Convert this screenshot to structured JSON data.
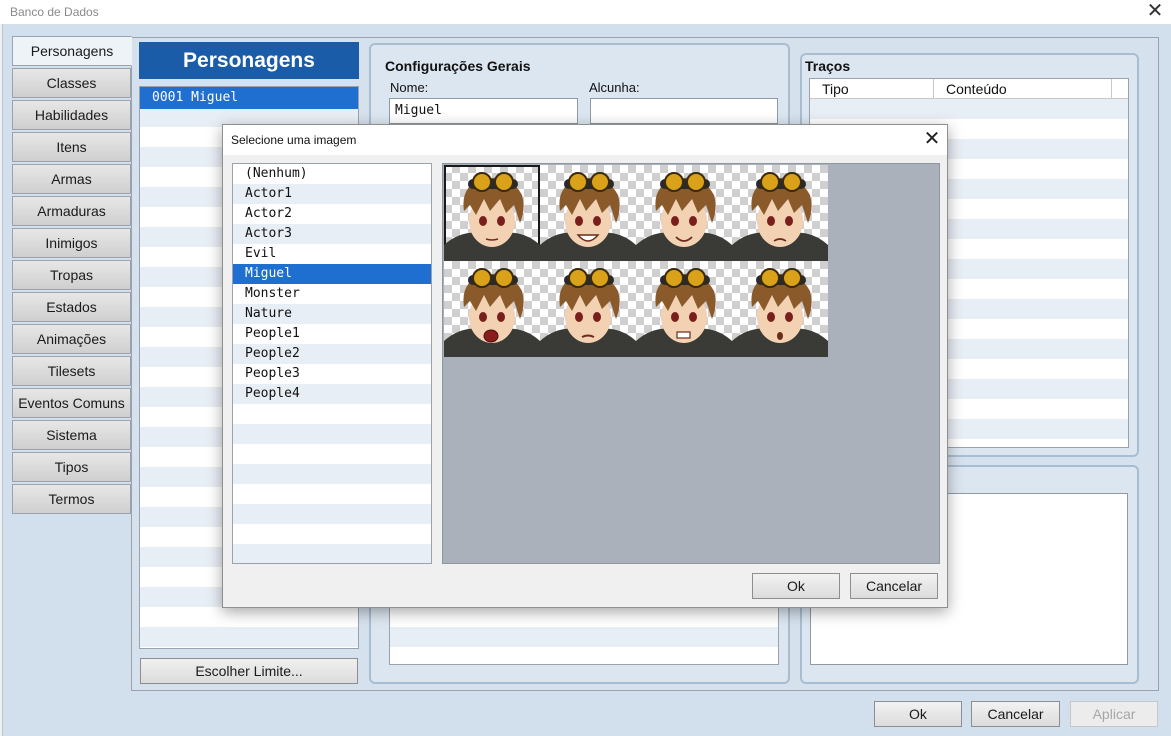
{
  "window": {
    "title": "Banco de Dados",
    "close_glyph": "✕"
  },
  "sidebar": {
    "tabs": [
      {
        "label": "Personagens",
        "active": true
      },
      {
        "label": "Classes"
      },
      {
        "label": "Habilidades"
      },
      {
        "label": "Itens"
      },
      {
        "label": "Armas"
      },
      {
        "label": "Armaduras"
      },
      {
        "label": "Inimigos"
      },
      {
        "label": "Tropas"
      },
      {
        "label": "Estados"
      },
      {
        "label": "Animações"
      },
      {
        "label": "Tilesets"
      },
      {
        "label": "Eventos Comuns"
      },
      {
        "label": "Sistema"
      },
      {
        "label": "Tipos"
      },
      {
        "label": "Termos"
      }
    ]
  },
  "actors": {
    "header": "Personagens",
    "items": [
      "0001 Miguel"
    ],
    "limit_button": "Escolher Limite..."
  },
  "general": {
    "title": "Configurações Gerais",
    "name_label": "Nome:",
    "name_value": "Miguel",
    "nickname_label": "Alcunha:",
    "nickname_value": ""
  },
  "traits": {
    "title": "Traços",
    "columns": [
      "Tipo",
      "Conteúdo"
    ]
  },
  "footer": {
    "ok": "Ok",
    "cancel": "Cancelar",
    "apply": "Aplicar"
  },
  "dialog": {
    "title": "Selecione uma imagem",
    "close_glyph": "✕",
    "folders": [
      "(Nenhum)",
      "Actor1",
      "Actor2",
      "Actor3",
      "Evil",
      "Miguel",
      "Monster",
      "Nature",
      "People1",
      "People2",
      "People3",
      "People4"
    ],
    "selected_folder": "Miguel",
    "faces": [
      {
        "expression": "neutral",
        "selected": true
      },
      {
        "expression": "grin"
      },
      {
        "expression": "smile"
      },
      {
        "expression": "sad"
      },
      {
        "expression": "shout"
      },
      {
        "expression": "angry"
      },
      {
        "expression": "clenched"
      },
      {
        "expression": "surprised"
      }
    ],
    "ok": "Ok",
    "cancel": "Cancelar"
  },
  "colors": {
    "accent": "#1e6fd0",
    "header_blue": "#1a5ca8",
    "panel_bg": "#d5e1ed",
    "hair": "#8a5a2b",
    "goggles": "#d9a21a",
    "hood": "#3a3a36"
  }
}
